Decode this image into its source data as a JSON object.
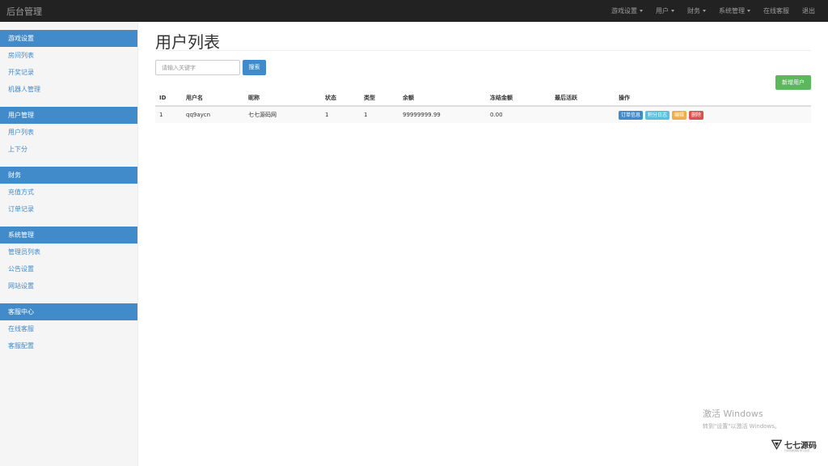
{
  "topbar": {
    "brand": "后台管理",
    "nav": [
      {
        "label": "游戏设置",
        "dropdown": true
      },
      {
        "label": "用户",
        "dropdown": true
      },
      {
        "label": "财务",
        "dropdown": true
      },
      {
        "label": "系统管理",
        "dropdown": true
      },
      {
        "label": "在线客服",
        "dropdown": false
      },
      {
        "label": "退出",
        "dropdown": false
      }
    ]
  },
  "sidebar": {
    "groups": [
      {
        "header": "游戏设置",
        "items": [
          "房间列表",
          "开奖记录",
          "机器人管理"
        ]
      },
      {
        "header": "用户管理",
        "items": [
          "用户列表",
          "上下分"
        ]
      },
      {
        "header": "财务",
        "items": [
          "充值方式",
          "订单记录"
        ]
      },
      {
        "header": "系统管理",
        "items": [
          "管理员列表",
          "公告设置",
          "网站设置"
        ]
      },
      {
        "header": "客服中心",
        "items": [
          "在线客服",
          "客服配置"
        ]
      }
    ]
  },
  "main": {
    "title": "用户列表",
    "search": {
      "placeholder": "请输入关键字",
      "button": "搜索"
    },
    "add_button": "新增用户",
    "table": {
      "columns": [
        "ID",
        "用户名",
        "昵称",
        "状态",
        "类型",
        "余额",
        "冻结金额",
        "最后活跃",
        "操作"
      ],
      "rows": [
        {
          "id": "1",
          "username": "qq9aycn",
          "nickname": "七七源码网",
          "status": "1",
          "type": "1",
          "balance": "99999999.99",
          "frozen": "0.00",
          "last_active": ""
        }
      ],
      "actions": [
        "订单信息",
        "积分日志",
        "编辑",
        "删除"
      ]
    }
  },
  "watermark": {
    "title": "激活 Windows",
    "subtitle": "转到\"设置\"以激活 Windows。"
  },
  "logo": {
    "text": "七七源码",
    "sub": "分享优质源码·学习交流"
  },
  "colors": {
    "primary": "#428bca",
    "success": "#5cb85c",
    "info": "#5bc0de",
    "warning": "#f0ad4e",
    "danger": "#d9534f",
    "navbar": "#222222"
  }
}
